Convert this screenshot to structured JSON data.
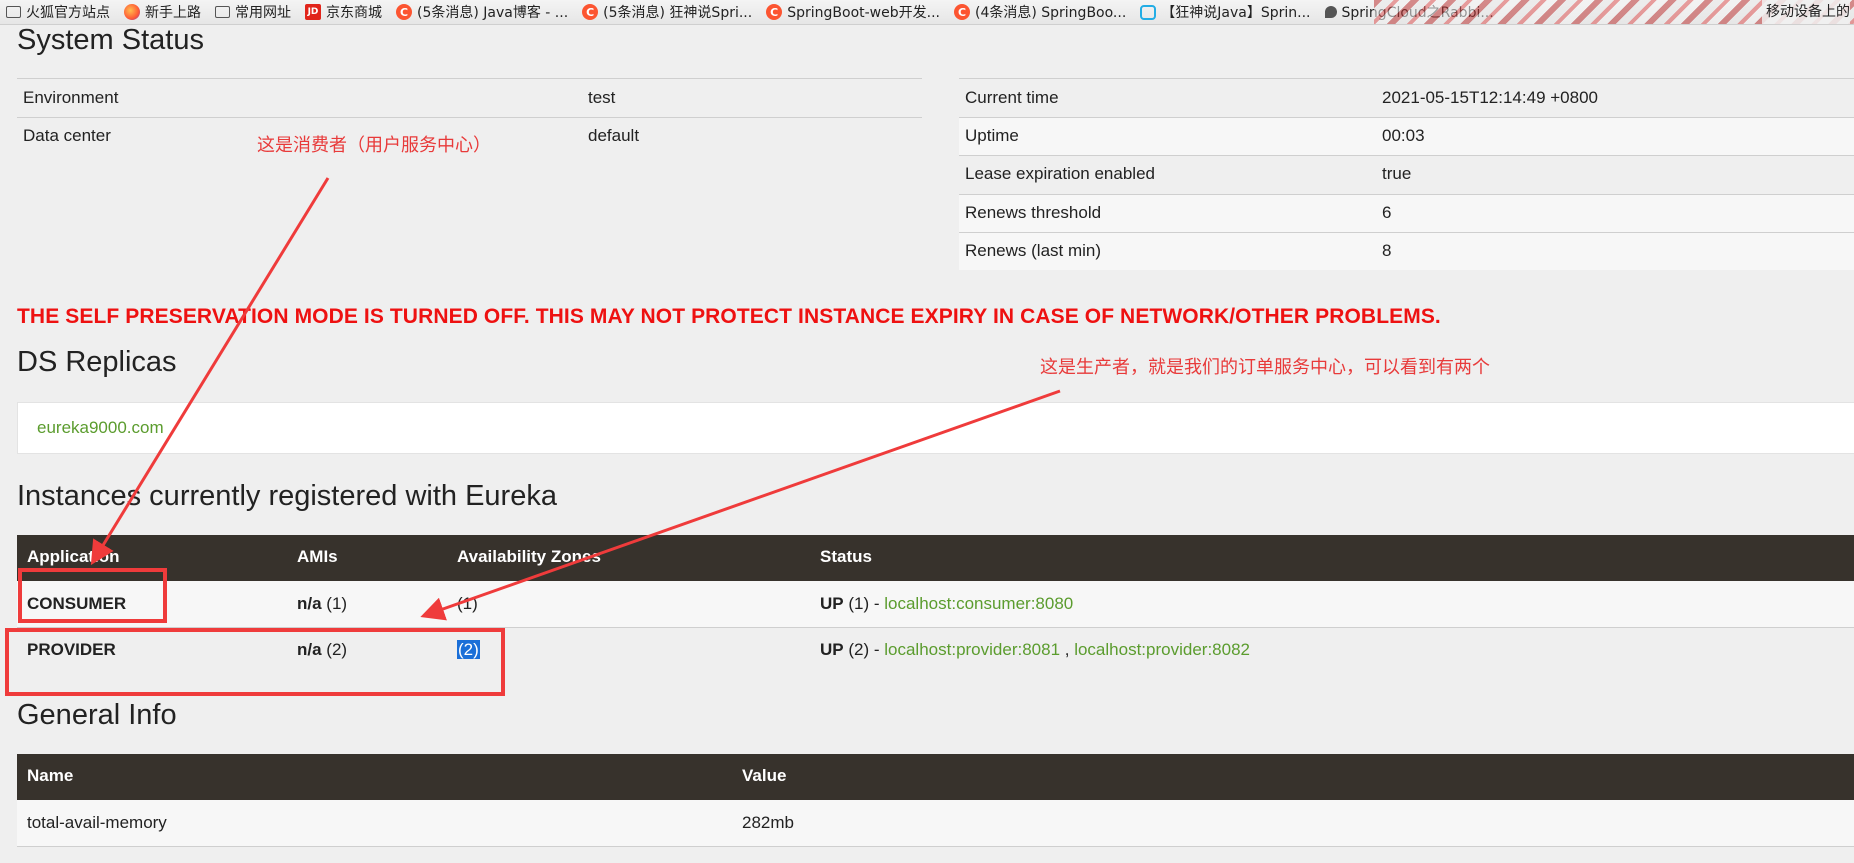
{
  "bookmarks": [
    {
      "icon": "folder-icon",
      "label": "火狐官方站点"
    },
    {
      "icon": "firefox-icon",
      "label": "新手上路"
    },
    {
      "icon": "folder-icon",
      "label": "常用网址"
    },
    {
      "icon": "jd-icon",
      "label": "京东商城"
    },
    {
      "icon": "csdn-icon",
      "label": "(5条消息) Java博客 - ..."
    },
    {
      "icon": "csdn-icon",
      "label": "(5条消息) 狂神说Spri..."
    },
    {
      "icon": "csdn-icon",
      "label": "SpringBoot-web开发..."
    },
    {
      "icon": "csdn-icon",
      "label": "(4条消息) SpringBoo..."
    },
    {
      "icon": "bilibili-icon",
      "label": "【狂神说Java】Sprin..."
    },
    {
      "icon": "pin-icon",
      "label": "SpringCloud之Rabbi..."
    }
  ],
  "bookmarks_right": "移动设备上的",
  "system_status": {
    "title": "System Status",
    "left_rows": [
      {
        "label": "Environment",
        "value": "test"
      },
      {
        "label": "Data center",
        "value": "default"
      }
    ],
    "right_rows": [
      {
        "label": "Current time",
        "value": "2021-05-15T12:14:49 +0800"
      },
      {
        "label": "Uptime",
        "value": "00:03"
      },
      {
        "label": "Lease expiration enabled",
        "value": "true"
      },
      {
        "label": "Renews threshold",
        "value": "6"
      },
      {
        "label": "Renews (last min)",
        "value": "8"
      }
    ]
  },
  "warning": "THE SELF PRESERVATION MODE IS TURNED OFF. THIS MAY NOT PROTECT INSTANCE EXPIRY IN CASE OF NETWORK/OTHER PROBLEMS.",
  "replicas": {
    "title": "DS Replicas",
    "link": "eureka9000.com"
  },
  "instances": {
    "title": "Instances currently registered with Eureka",
    "columns": [
      "Application",
      "AMIs",
      "Availability Zones",
      "Status"
    ],
    "rows": [
      {
        "app": "CONSUMER",
        "ami_bold": "n/a",
        "ami_count": "(1)",
        "zones": "(1)",
        "status_bold": "UP",
        "status_count": "(1) - ",
        "links": [
          "localhost:consumer:8080"
        ]
      },
      {
        "app": "PROVIDER",
        "ami_bold": "n/a",
        "ami_count": "(2)",
        "zones": "(2)",
        "status_bold": "UP",
        "status_count": "(2) - ",
        "links": [
          "localhost:provider:8081",
          "localhost:provider:8082"
        ],
        "link_sep": " , "
      }
    ]
  },
  "general_info": {
    "title": "General Info",
    "columns": [
      "Name",
      "Value"
    ],
    "rows": [
      {
        "name": "total-avail-memory",
        "value": "282mb"
      }
    ]
  },
  "annotations": {
    "consumer_note": "这是消费者（用户服务中心）",
    "provider_note": "这是生产者，就是我们的订单服务中心，可以看到有两个"
  },
  "colors": {
    "header_bg": "#37322c",
    "link": "#5b9c2e",
    "warning": "#ee1111",
    "annotation": "#ef3b3b",
    "selection": "#1a6fd8"
  }
}
